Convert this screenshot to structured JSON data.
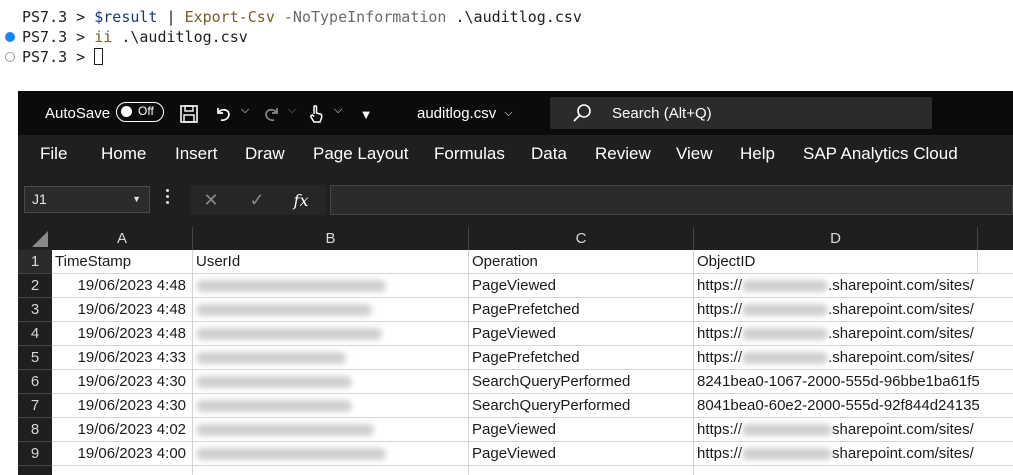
{
  "terminal": {
    "prompt": "PS7.3 > ",
    "line1": {
      "var": "$result",
      "pipe": " | ",
      "cmd": "Export-Csv",
      "param": " -NoTypeInformation",
      "arg": " .\\auditlog.csv"
    },
    "line2": {
      "cmd": "ii",
      "arg": " .\\auditlog.csv"
    },
    "line3": {
      "cursor": ""
    }
  },
  "titlebar": {
    "autosave_label": "AutoSave",
    "autosave_state": "Off",
    "filename": "auditlog.csv",
    "search_placeholder": "Search (Alt+Q)"
  },
  "menubar": [
    "File",
    "Home",
    "Insert",
    "Draw",
    "Page Layout",
    "Formulas",
    "Data",
    "Review",
    "View",
    "Help",
    "SAP Analytics Cloud"
  ],
  "formula_bar": {
    "name_box": "J1",
    "fx_label": "fx",
    "formula": ""
  },
  "sheet": {
    "columns": [
      "A",
      "B",
      "C",
      "D"
    ],
    "row_numbers": [
      "1",
      "2",
      "3",
      "4",
      "5",
      "6",
      "7",
      "8",
      "9"
    ],
    "header": [
      "TimeStamp",
      "UserId",
      "Operation",
      "ObjectID"
    ],
    "rows": [
      {
        "timestamp": "19/06/2023 4:48",
        "operation": "PageViewed",
        "object_prefix": "https://",
        "object_suffix": ".sharepoint.com/sites/"
      },
      {
        "timestamp": "19/06/2023 4:48",
        "operation": "PagePrefetched",
        "object_prefix": "https://",
        "object_suffix": ".sharepoint.com/sites/"
      },
      {
        "timestamp": "19/06/2023 4:48",
        "operation": "PageViewed",
        "object_prefix": "https://",
        "object_suffix": ".sharepoint.com/sites/"
      },
      {
        "timestamp": "19/06/2023 4:33",
        "operation": "PagePrefetched",
        "object_prefix": "https://",
        "object_suffix": ".sharepoint.com/sites/"
      },
      {
        "timestamp": "19/06/2023 4:30",
        "operation": "SearchQueryPerformed",
        "object_prefix": "8241bea0-1067-2000-555d-96bbe1ba61f5",
        "object_suffix": ""
      },
      {
        "timestamp": "19/06/2023 4:30",
        "operation": "SearchQueryPerformed",
        "object_prefix": "8041bea0-60e2-2000-555d-92f844d24135",
        "object_suffix": ""
      },
      {
        "timestamp": "19/06/2023 4:02",
        "operation": "PageViewed",
        "object_prefix": "https://",
        "object_suffix": "sharepoint.com/sites/"
      },
      {
        "timestamp": "19/06/2023 4:00",
        "operation": "PageViewed",
        "object_prefix": "https://",
        "object_suffix": "sharepoint.com/sites/"
      }
    ]
  }
}
